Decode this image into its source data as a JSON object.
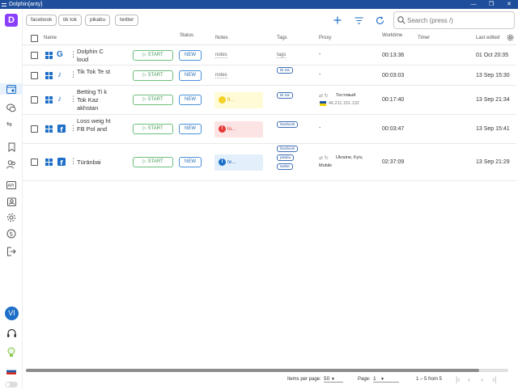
{
  "window": {
    "title": "Dolphin{anty}",
    "controls": [
      "—",
      "❐",
      "✕"
    ]
  },
  "logo": "D",
  "sidebar": {
    "items": [
      {
        "icon": "browser-profiles-icon"
      },
      {
        "icon": "chat-icon"
      },
      {
        "icon": "swap-icon"
      },
      {
        "icon": "bookmark-icon"
      },
      {
        "icon": "user-group-icon"
      },
      {
        "icon": "api-icon"
      },
      {
        "icon": "person-card-icon"
      },
      {
        "icon": "settings-icon"
      },
      {
        "icon": "billing-icon"
      },
      {
        "icon": "logout-icon"
      }
    ],
    "avatar": "VI",
    "support_icon": "headset-icon",
    "tips_icon": "lightbulb-icon",
    "language_icon": "flag-ru-icon"
  },
  "filters": {
    "tags": [
      "facebook",
      "tik tok",
      "pikabu",
      "twitter"
    ]
  },
  "search": {
    "placeholder": "Search (press /)"
  },
  "columns": {
    "name": "Name",
    "status": "Status",
    "notes": "Notes",
    "tags": "Tags",
    "proxy": "Proxy",
    "worktime": "Worktime",
    "timer": "Timer",
    "last_edited": "Last edited"
  },
  "start_label": "START",
  "rows": [
    {
      "name": "Dolphin C loud",
      "os": "windows-icon",
      "site": "google-icon",
      "status": "NEW",
      "note": "notes",
      "note_style": "plain",
      "tags": [
        "tags"
      ],
      "tag_style": "plain",
      "proxy": "-",
      "worktime": "00:13:36",
      "last_edited": "01 Oct 20:35"
    },
    {
      "name": "Tik Tok Te st",
      "os": "windows-icon",
      "site": "tiktok-icon",
      "status": "NEW",
      "note": "notes",
      "note_style": "plain",
      "tags": [
        "tik tok"
      ],
      "tag_style": "chip",
      "proxy": "-",
      "worktime": "00:03:03",
      "last_edited": "13 Sep 15:30"
    },
    {
      "name": "Betting Ti k Tok Kaz akhstan",
      "os": "windows-icon",
      "site": "tiktok-icon",
      "status": "NEW",
      "note": "fl...",
      "note_style": "yellow",
      "tags": [
        "tik tok"
      ],
      "tag_style": "chip",
      "proxy_name": "Тестовый",
      "proxy_ip": "46.211.151.132",
      "worktime": "00:17:40",
      "last_edited": "13 Sep 21:34"
    },
    {
      "name": "Loss weig ht FB Pol and",
      "os": "windows-icon",
      "site": "facebook-icon",
      "status": "NEW",
      "note": "lo...",
      "note_style": "red",
      "tags": [
        "facebook"
      ],
      "tag_style": "chip",
      "proxy": "-",
      "worktime": "00:03:47",
      "last_edited": "13 Sep 15:41"
    },
    {
      "name": "Türänbai",
      "os": "windows-icon",
      "site": "facebook-icon",
      "status": "NEW",
      "note": "te...",
      "note_style": "blue",
      "tags": [
        "facebook",
        "pikabu",
        "twitter"
      ],
      "tag_style": "chip",
      "proxy_name": "Ukraine, Kyiv,",
      "proxy_ip": "Mobile",
      "worktime": "02:37:09",
      "last_edited": "13 Sep 21:29"
    }
  ],
  "pagination": {
    "items_label": "Items per page:",
    "items_value": "50",
    "page_label": "Page:",
    "page_value": "1",
    "range": "1 – 5 from 5"
  },
  "colors": {
    "accent": "#1e6fc7",
    "title_bar": "#1f4e9c",
    "start_green": "#4a9b5a",
    "logo_purple": "#8a3ffc"
  }
}
